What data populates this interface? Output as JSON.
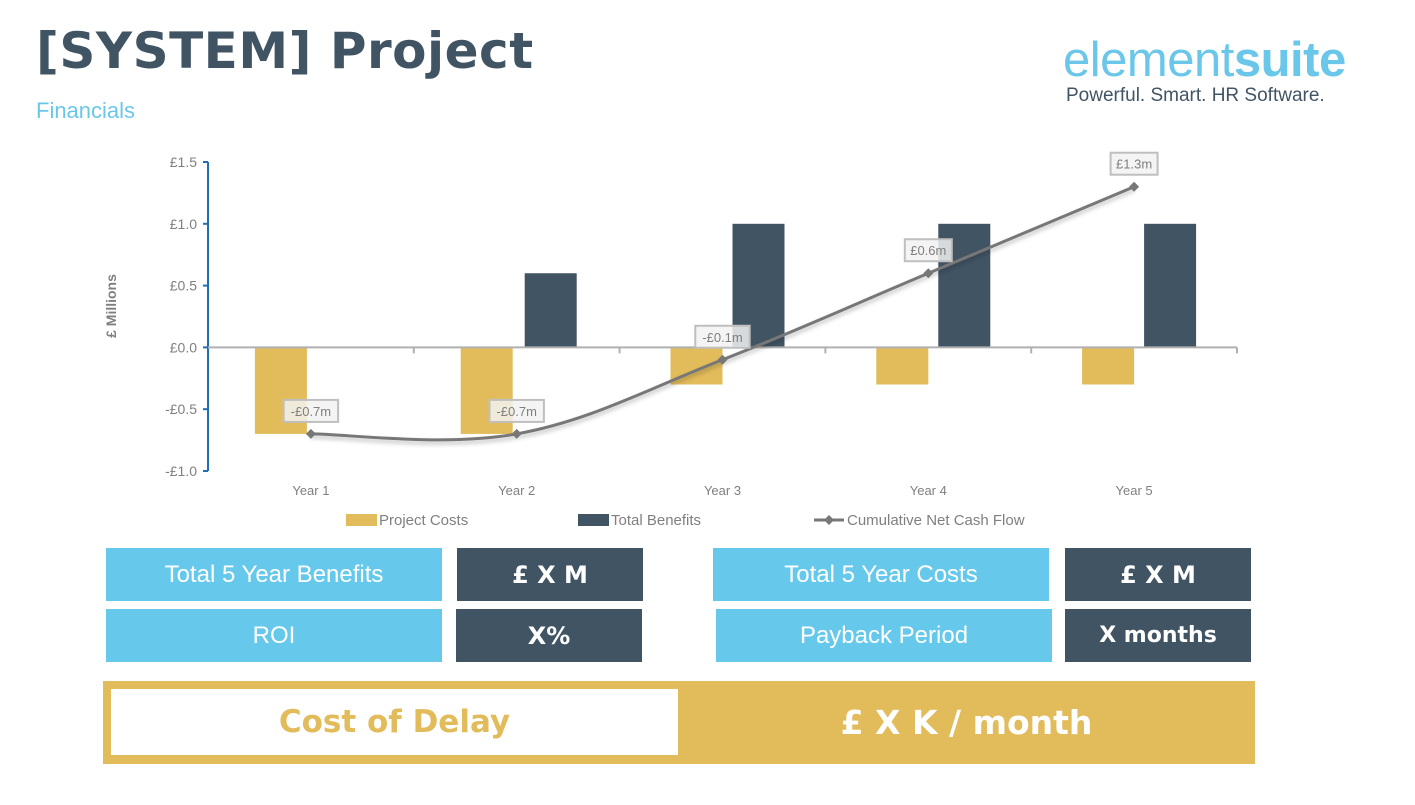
{
  "header": {
    "title": "[SYSTEM] Project",
    "subtitle": "Financials"
  },
  "logo": {
    "word_light": "element",
    "word_bold": "suite",
    "tagline": "Powerful. Smart. HR Software."
  },
  "colors": {
    "costs": "#e2bb5a",
    "benefits": "#415464",
    "line": "#777777",
    "axis": "#1f6fb2",
    "accent_blue": "#66c9ec",
    "dark": "#415464",
    "gold": "#e2bb5a"
  },
  "chart_data": {
    "type": "bar",
    "title": "",
    "xlabel": "",
    "ylabel": "£ Millions",
    "ylim": [
      -1.0,
      1.5
    ],
    "yticks": [
      1.5,
      1.0,
      0.5,
      0.0,
      -0.5,
      -1.0
    ],
    "ytick_labels": [
      "£1.5",
      "£1.0",
      "£0.5",
      "£0.0",
      "-£0.5",
      "-£1.0"
    ],
    "categories": [
      "Year 1",
      "Year 2",
      "Year 3",
      "Year 4",
      "Year 5"
    ],
    "series": [
      {
        "name": "Project Costs",
        "type": "bar",
        "values": [
          -0.7,
          -0.7,
          -0.3,
          -0.3,
          -0.3
        ]
      },
      {
        "name": "Total Benefits",
        "type": "bar",
        "values": [
          0.0,
          0.6,
          1.0,
          1.0,
          1.0
        ]
      },
      {
        "name": "Cumulative Net Cash Flow",
        "type": "line",
        "values": [
          -0.7,
          -0.7,
          -0.1,
          0.6,
          1.3
        ],
        "data_labels": [
          "-£0.7m",
          "-£0.7m",
          "-£0.1m",
          "£0.6m",
          "£1.3m"
        ]
      }
    ],
    "grid": false,
    "legend": "bottom"
  },
  "kpis": {
    "benefits_label": "Total 5 Year Benefits",
    "benefits_value": "£ X M",
    "costs_label": "Total 5 Year Costs",
    "costs_value": "£ X M",
    "roi_label": "ROI",
    "roi_value": "X%",
    "payback_label": "Payback Period",
    "payback_value": "X months"
  },
  "cost_of_delay": {
    "label": "Cost of Delay",
    "value": "£ X K / month"
  }
}
